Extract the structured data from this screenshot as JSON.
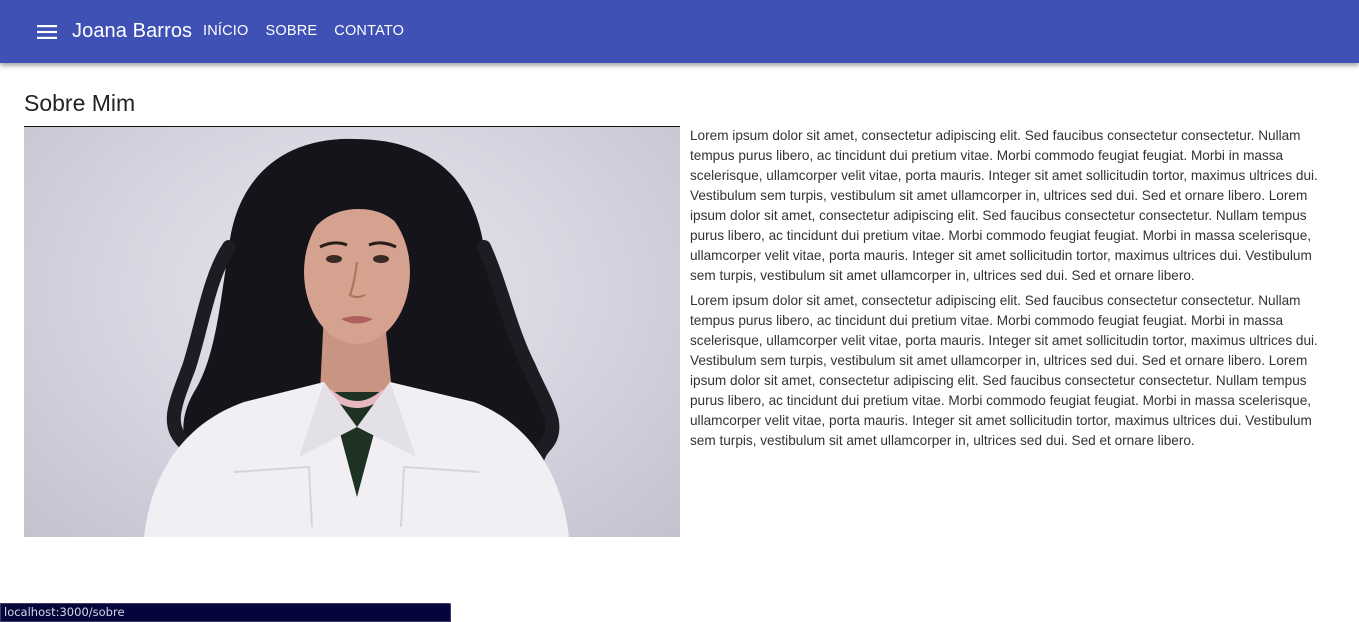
{
  "header": {
    "brand": "Joana Barros",
    "menu_icon": "hamburger-menu-icon",
    "nav": [
      {
        "label": "INÍCIO"
      },
      {
        "label": "SOBRE"
      },
      {
        "label": "CONTATO"
      }
    ],
    "color": "#3f51b5"
  },
  "main": {
    "title": "Sobre Mim",
    "photo": {
      "icon": "portrait-photo"
    },
    "paragraphs": [
      "Lorem ipsum dolor sit amet, consectetur adipiscing elit. Sed faucibus consectetur consectetur. Nullam tempus purus libero, ac tincidunt dui pretium vitae. Morbi commodo feugiat feugiat. Morbi in massa scelerisque, ullamcorper velit vitae, porta mauris. Integer sit amet sollicitudin tortor, maximus ultrices dui. Vestibulum sem turpis, vestibulum sit amet ullamcorper in, ultrices sed dui. Sed et ornare libero. Lorem ipsum dolor sit amet, consectetur adipiscing elit. Sed faucibus consectetur consectetur. Nullam tempus purus libero, ac tincidunt dui pretium vitae. Morbi commodo feugiat feugiat. Morbi in massa scelerisque, ullamcorper velit vitae, porta mauris. Integer sit amet sollicitudin tortor, maximus ultrices dui. Vestibulum sem turpis, vestibulum sit amet ullamcorper in, ultrices sed dui. Sed et ornare libero.",
      "Lorem ipsum dolor sit amet, consectetur adipiscing elit. Sed faucibus consectetur consectetur. Nullam tempus purus libero, ac tincidunt dui pretium vitae. Morbi commodo feugiat feugiat. Morbi in massa scelerisque, ullamcorper velit vitae, porta mauris. Integer sit amet sollicitudin tortor, maximus ultrices dui. Vestibulum sem turpis, vestibulum sit amet ullamcorper in, ultrices sed dui. Sed et ornare libero. Lorem ipsum dolor sit amet, consectetur adipiscing elit. Sed faucibus consectetur consectetur. Nullam tempus purus libero, ac tincidunt dui pretium vitae. Morbi commodo feugiat feugiat. Morbi in massa scelerisque, ullamcorper velit vitae, porta mauris. Integer sit amet sollicitudin tortor, maximus ultrices dui. Vestibulum sem turpis, vestibulum sit amet ullamcorper in, ultrices sed dui. Sed et ornare libero."
    ]
  },
  "status_bar": {
    "url": "localhost:3000/sobre"
  }
}
